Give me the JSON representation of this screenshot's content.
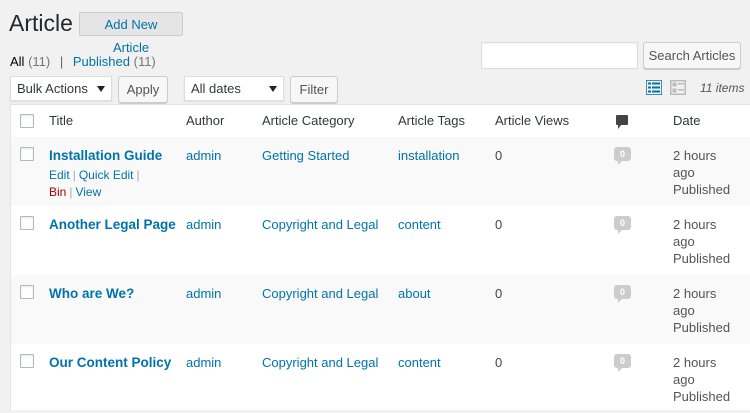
{
  "header": {
    "title": "Article",
    "add_new": "Add New Article"
  },
  "filters": {
    "all_label": "All",
    "all_count": "(11)",
    "separator": "|",
    "published_label": "Published",
    "published_count": "(11)"
  },
  "search": {
    "button": "Search Articles",
    "value": ""
  },
  "toolbar": {
    "bulk_actions": "Bulk Actions",
    "apply": "Apply",
    "dates": "All dates",
    "filter": "Filter",
    "items_count": "11 items",
    "view_icons": [
      "list-view-icon",
      "excerpt-view-icon"
    ]
  },
  "table": {
    "columns": {
      "title": "Title",
      "author": "Author",
      "category": "Article Category",
      "tags": "Article Tags",
      "views": "Article Views",
      "comments_icon": "comment-bubble-icon",
      "date": "Date"
    },
    "row_actions": {
      "edit": "Edit",
      "quick_edit": "Quick Edit",
      "bin": "Bin",
      "view": "View",
      "sep": "|"
    },
    "rows": [
      {
        "title": "Installation Guide",
        "author": "admin",
        "category": "Getting Started",
        "tags": "installation",
        "views": "0",
        "comments": "0",
        "date_1": "2 hours",
        "date_2": "ago",
        "status": "Published"
      },
      {
        "title": "Another Legal Page",
        "author": "admin",
        "category": "Copyright and Legal",
        "tags": "content",
        "views": "0",
        "comments": "0",
        "date_1": "2 hours",
        "date_2": "ago",
        "status": "Published"
      },
      {
        "title": "Who are We?",
        "author": "admin",
        "category": "Copyright and Legal",
        "tags": "about",
        "views": "0",
        "comments": "0",
        "date_1": "2 hours",
        "date_2": "ago",
        "status": "Published"
      },
      {
        "title": "Our Content Policy",
        "author": "admin",
        "category": "Copyright and Legal",
        "tags": "content",
        "views": "0",
        "comments": "0",
        "date_1": "2 hours",
        "date_2": "ago",
        "status": "Published"
      }
    ]
  },
  "colors": {
    "link": "#0073aa",
    "background": "#f1f1f1",
    "trash": "#aa0000",
    "alt_row": "#f9f9f9"
  }
}
